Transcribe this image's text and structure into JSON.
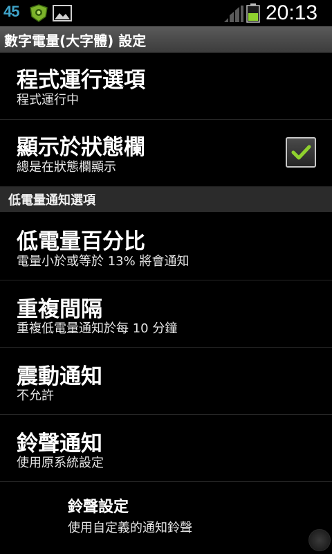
{
  "status_bar": {
    "battery_percent_icon": "45",
    "app_icon": "shield-app-icon",
    "image_icon": "picture-icon",
    "signal_icon": "signal-bars-icon",
    "battery_icon": "battery-icon",
    "clock": "20:13"
  },
  "title_bar": {
    "title": "數字電量(大字體) 設定"
  },
  "preferences": [
    {
      "title": "程式運行選項",
      "summary": "程式運行中"
    },
    {
      "title": "顯示於狀態欄",
      "summary": "總是在狀態欄顯示",
      "checked": true
    }
  ],
  "category": {
    "label": "低電量通知選項"
  },
  "notification_prefs": [
    {
      "title": "低電量百分比",
      "summary": "電量小於或等於 13% 將會通知"
    },
    {
      "title": "重複間隔",
      "summary": "重複低電量通知於每 10 分鐘"
    },
    {
      "title": "震動通知",
      "summary": "不允許"
    },
    {
      "title": "鈴聲通知",
      "summary": "使用原系統設定"
    }
  ],
  "sub_pref": {
    "title": "鈴聲設定",
    "summary": "使用自定義的通知鈴聲"
  },
  "colors": {
    "background": "#000000",
    "checkmark": "#8fd12e",
    "battery_text": "#3fa3c9"
  }
}
